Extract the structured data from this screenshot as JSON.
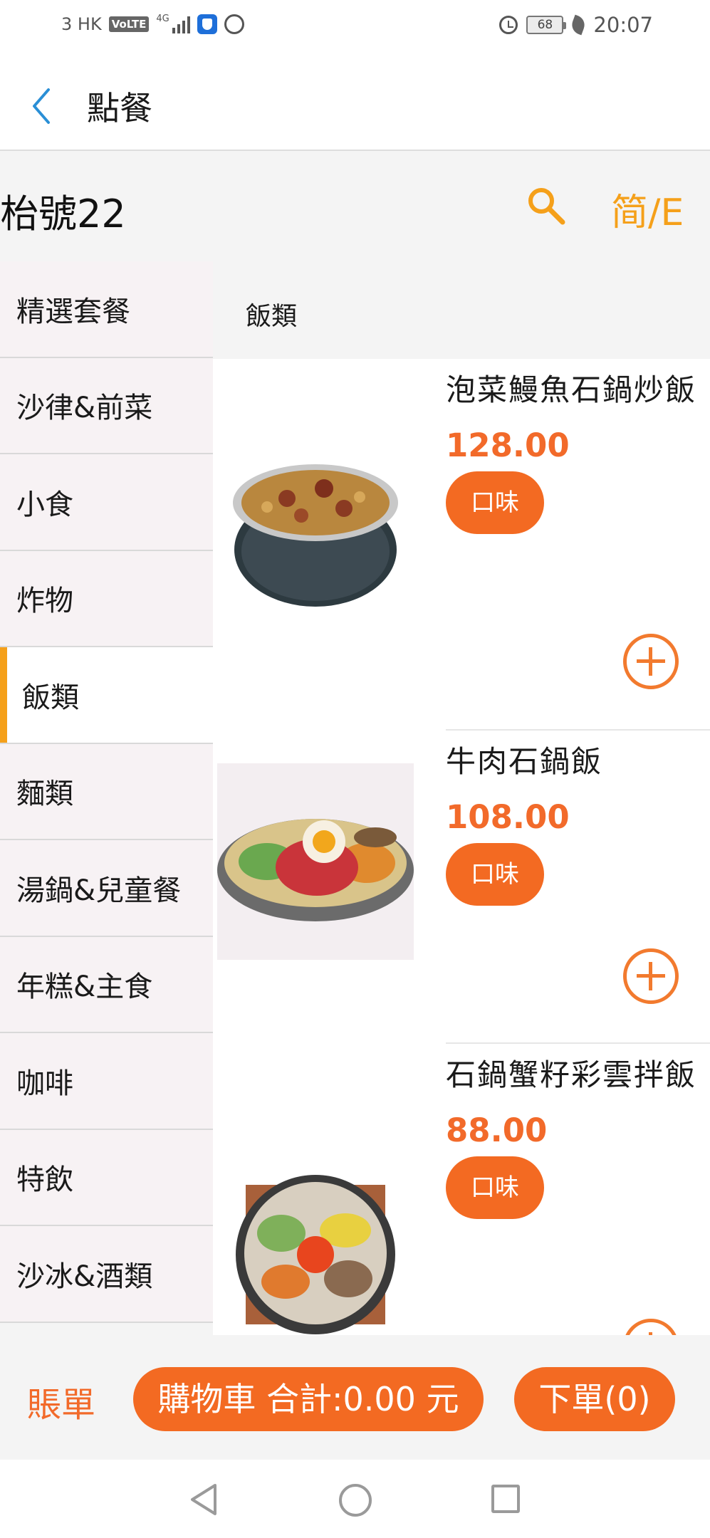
{
  "status_bar": {
    "carrier": "3 HK",
    "volte": "VoLTE",
    "network": "4G",
    "battery": "68",
    "time": "20:07"
  },
  "header": {
    "title": "點餐",
    "back_icon": "chevron-left-icon"
  },
  "table": {
    "name": "枱號22",
    "search_icon": "search-icon",
    "language_toggle": "简/E"
  },
  "categories": [
    {
      "label": "精選套餐"
    },
    {
      "label": "沙律&前菜"
    },
    {
      "label": "小食"
    },
    {
      "label": "炸物"
    },
    {
      "label": "飯類",
      "active": true
    },
    {
      "label": "麵類"
    },
    {
      "label": "湯鍋&兒童餐"
    },
    {
      "label": "年糕&主食"
    },
    {
      "label": "咖啡"
    },
    {
      "label": "特飲"
    },
    {
      "label": "沙冰&酒類"
    }
  ],
  "section": {
    "title": "飯類"
  },
  "items": [
    {
      "name": "泡菜鰻魚石鍋炒飯",
      "price": "128.00",
      "flavor_label": "口味"
    },
    {
      "name": "牛肉石鍋飯",
      "price": "108.00",
      "flavor_label": "口味"
    },
    {
      "name": "石鍋蟹籽彩雲拌飯",
      "price": "88.00",
      "flavor_label": "口味"
    }
  ],
  "bottom_bar": {
    "bill_label": "賬單",
    "cart_label": "購物車 合計:0.00 元",
    "order_label": "下單(0)"
  },
  "colors": {
    "accent_orange": "#f36a22",
    "price_orange": "#f26a2a",
    "highlight_yellow": "#f5a01a",
    "back_blue": "#2a8fd6"
  }
}
